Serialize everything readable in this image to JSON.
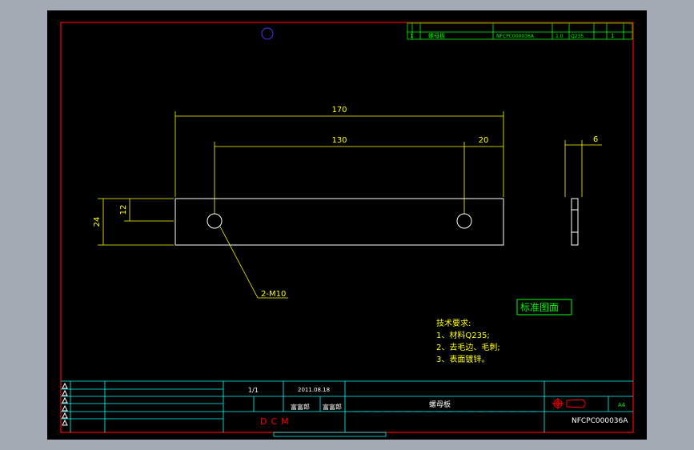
{
  "colors": {
    "background": "#000000",
    "frame": "#ff0000",
    "titleblock": "#00ffff",
    "dimension": "#ffff00",
    "outline": "#ffffff",
    "stamp": "#00ff00"
  },
  "dimensions": {
    "overall_length": "170",
    "hole_spacing": "130",
    "edge_to_hole": "20",
    "thickness": "6",
    "height": "24",
    "hole_height": "12",
    "hole_callout": "2-M10"
  },
  "stamp": "标准图面",
  "notes": {
    "title": "技术要求:",
    "items": [
      "1、材料Q235;",
      "2、去毛边、毛刺;",
      "3、表面镀锌。"
    ]
  },
  "parts_list": {
    "row": {
      "index": "1",
      "name": "螺母板",
      "code": "NFCPC000036A",
      "qty": "1.0",
      "material": "Q235",
      "count": "1"
    }
  },
  "title_block": {
    "scale": "1/1",
    "date": "2011.08.18",
    "designer": "富富郎",
    "checker": "富富郎",
    "part_name": "螺母板",
    "company": "DCM",
    "drawing_number": "NFCPC000036A",
    "sheet_size": "A4"
  }
}
